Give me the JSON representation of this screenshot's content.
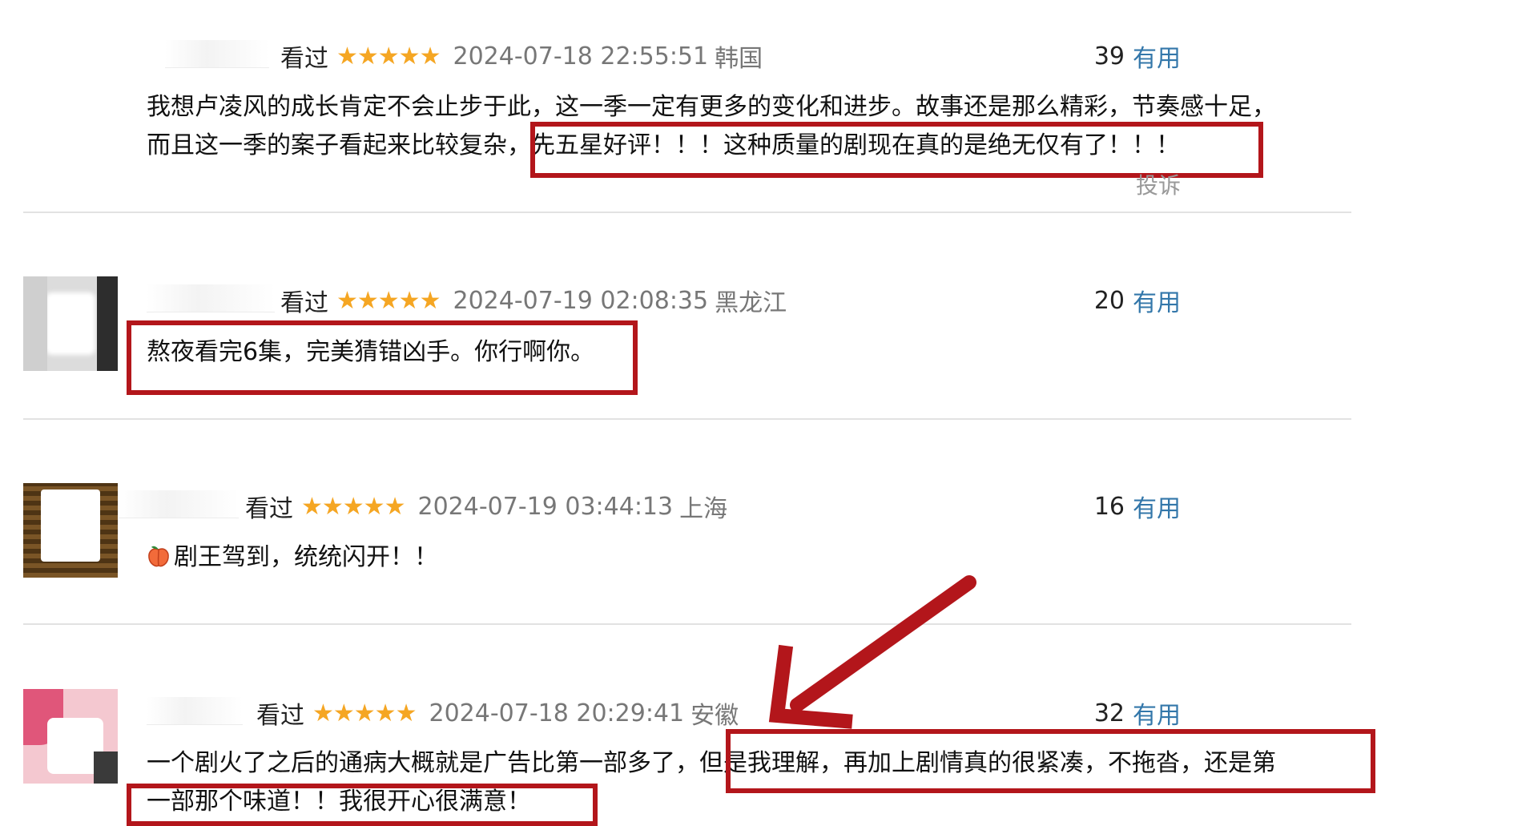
{
  "reviews": [
    {
      "watched": "看过",
      "stars": "★★★★★",
      "time": "2024-07-18 22:55:51",
      "location": "韩国",
      "useful_count": "39",
      "useful_label": "有用",
      "content_line1": "我想卢凌风的成长肯定不会止步于此，这一季一定有更多的变化和进步。故事还是那么精彩，节奏感十足，",
      "content_line2_a": "而且这一季的案子看起来比较复杂，",
      "content_line2_b": "先五星好评！！！这种质量的剧现在真的是绝无仅有了！！！",
      "report": "投诉"
    },
    {
      "watched": "看过",
      "stars": "★★★★★",
      "time": "2024-07-19 02:08:35",
      "location": "黑龙江",
      "useful_count": "20",
      "useful_label": "有用",
      "content": "熬夜看完6集，完美猜错凶手。你行啊你。"
    },
    {
      "watched": "看过",
      "stars": "★★★★★",
      "time": "2024-07-19 03:44:13",
      "location": "上海",
      "useful_count": "16",
      "useful_label": "有用",
      "content": "剧王驾到，统统闪开！！"
    },
    {
      "watched": "看过",
      "stars": "★★★★★",
      "time": "2024-07-18 20:29:41",
      "location": "安徽",
      "useful_count": "32",
      "useful_label": "有用",
      "content_line1_a": "一个剧火了之后的通病大概就是广告比第一部多了，",
      "content_line1_b": "但是我理解，再加上剧情真的很紧凑，不拖沓，还是第",
      "content_line2": "一部那个味道！！我很开心很满意！"
    }
  ],
  "colors": {
    "star": "#f5a623",
    "useful_link": "#3377aa",
    "highlight": "#b3161b",
    "meta_gray": "#777777"
  },
  "icons": {
    "peach": "peach-emoji-icon",
    "arrow": "red-arrow-icon"
  }
}
